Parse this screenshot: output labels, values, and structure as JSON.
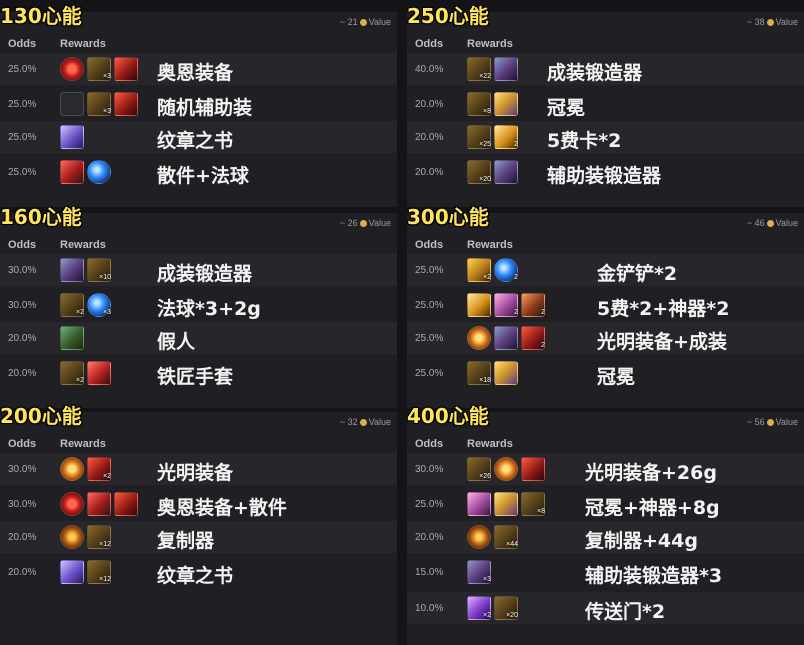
{
  "headers": {
    "odds": "Odds",
    "rewards": "Rewards"
  },
  "value_label": "Value",
  "panels": [
    {
      "tier": "130心能",
      "value": "~ 21",
      "rows": [
        {
          "odds": "25.0%",
          "name": "奥恩装备",
          "icons": [
            {
              "t": "orb-red",
              "c": ""
            },
            {
              "t": "chest",
              "c": "×3"
            },
            {
              "t": "anvil-red",
              "c": ""
            }
          ]
        },
        {
          "odds": "25.0%",
          "name": "随机辅助装",
          "icons": [
            {
              "t": "pill",
              "c": ""
            },
            {
              "t": "chest",
              "c": "×3"
            },
            {
              "t": "anvil-red",
              "c": ""
            }
          ]
        },
        {
          "odds": "25.0%",
          "name": "纹章之书",
          "icons": [
            {
              "t": "book",
              "c": ""
            }
          ]
        },
        {
          "odds": "25.0%",
          "name": "散件+法球",
          "icons": [
            {
              "t": "scarf",
              "c": ""
            },
            {
              "t": "orb-blue",
              "c": ""
            }
          ]
        }
      ]
    },
    {
      "tier": "250心能",
      "value": "~ 38",
      "rows": [
        {
          "odds": "40.0%",
          "name": "成装锻造器",
          "icons": [
            {
              "t": "chest",
              "c": "×22"
            },
            {
              "t": "anvil-blue",
              "c": ""
            }
          ]
        },
        {
          "odds": "20.0%",
          "name": "冠冕",
          "icons": [
            {
              "t": "chest",
              "c": "×8"
            },
            {
              "t": "crown",
              "c": ""
            }
          ]
        },
        {
          "odds": "20.0%",
          "name": "5费卡*2",
          "icons": [
            {
              "t": "chest",
              "c": "×25"
            },
            {
              "t": "card5",
              "c": "2"
            }
          ]
        },
        {
          "odds": "20.0%",
          "name": "辅助装锻造器",
          "icons": [
            {
              "t": "chest",
              "c": "×20"
            },
            {
              "t": "anvil-blue",
              "c": ""
            }
          ]
        }
      ]
    },
    {
      "tier": "160心能",
      "value": "~ 26",
      "rows": [
        {
          "odds": "30.0%",
          "name": "成装锻造器",
          "icons": [
            {
              "t": "anvil-blue",
              "c": ""
            },
            {
              "t": "chest",
              "c": "×10"
            }
          ]
        },
        {
          "odds": "30.0%",
          "name": "法球*3+2g",
          "icons": [
            {
              "t": "chest",
              "c": "×2"
            },
            {
              "t": "orb-blue",
              "c": "×3"
            }
          ]
        },
        {
          "odds": "20.0%",
          "name": "假人",
          "icons": [
            {
              "t": "dummy",
              "c": ""
            }
          ]
        },
        {
          "odds": "20.0%",
          "name": "铁匠手套",
          "icons": [
            {
              "t": "chest",
              "c": "×2"
            },
            {
              "t": "gauntlet",
              "c": ""
            }
          ]
        }
      ]
    },
    {
      "tier": "300心能",
      "value": "~ 46",
      "rows": [
        {
          "odds": "25.0%",
          "name": "金铲铲*2",
          "icons": [
            {
              "t": "shovel",
              "c": "×2"
            },
            {
              "t": "orb-blue",
              "c": "2"
            }
          ]
        },
        {
          "odds": "25.0%",
          "name": "5费*2+神器*2",
          "icons": [
            {
              "t": "card5",
              "c": ""
            },
            {
              "t": "unit-pink",
              "c": "2"
            },
            {
              "t": "artifact",
              "c": "2"
            }
          ]
        },
        {
          "odds": "25.0%",
          "name": "光明装备+成装",
          "icons": [
            {
              "t": "orb-gold",
              "c": ""
            },
            {
              "t": "anvil-blue",
              "c": ""
            },
            {
              "t": "anvil-red",
              "c": "2"
            }
          ]
        },
        {
          "odds": "25.0%",
          "name": "冠冕",
          "icons": [
            {
              "t": "chest",
              "c": "×18"
            },
            {
              "t": "crown",
              "c": ""
            }
          ]
        }
      ]
    },
    {
      "tier": "200心能",
      "value": "~ 32",
      "rows": [
        {
          "odds": "30.0%",
          "name": "光明装备",
          "icons": [
            {
              "t": "orb-gold",
              "c": ""
            },
            {
              "t": "anvil-red",
              "c": "×2"
            }
          ]
        },
        {
          "odds": "30.0%",
          "name": "奥恩装备+散件",
          "icons": [
            {
              "t": "orb-red",
              "c": ""
            },
            {
              "t": "scarf",
              "c": ""
            },
            {
              "t": "anvil-red",
              "c": ""
            }
          ]
        },
        {
          "odds": "20.0%",
          "name": "复制器",
          "icons": [
            {
              "t": "orb-copper",
              "c": ""
            },
            {
              "t": "chest",
              "c": "×12"
            }
          ]
        },
        {
          "odds": "20.0%",
          "name": "纹章之书",
          "icons": [
            {
              "t": "book",
              "c": ""
            },
            {
              "t": "chest",
              "c": "×12"
            }
          ]
        }
      ]
    },
    {
      "tier": "400心能",
      "value": "~ 56",
      "rows": [
        {
          "odds": "30.0%",
          "name": "光明装备+26g",
          "icons": [
            {
              "t": "chest",
              "c": "×26"
            },
            {
              "t": "orb-gold",
              "c": ""
            },
            {
              "t": "anvil-red",
              "c": ""
            }
          ]
        },
        {
          "odds": "25.0%",
          "name": "冠冕+神器+8g",
          "icons": [
            {
              "t": "unit-pink",
              "c": ""
            },
            {
              "t": "crown",
              "c": ""
            },
            {
              "t": "chest",
              "c": "×8"
            }
          ]
        },
        {
          "odds": "20.0%",
          "name": "复制器+44g",
          "icons": [
            {
              "t": "orb-copper",
              "c": ""
            },
            {
              "t": "chest",
              "c": "×44"
            }
          ]
        },
        {
          "odds": "15.0%",
          "name": "辅助装锻造器*3",
          "icons": [
            {
              "t": "anvil-blue",
              "c": "×3"
            }
          ]
        },
        {
          "odds": "10.0%",
          "name": "传送门*2",
          "icons": [
            {
              "t": "portal",
              "c": "×2"
            },
            {
              "t": "chest",
              "c": "×20"
            }
          ]
        }
      ]
    }
  ]
}
